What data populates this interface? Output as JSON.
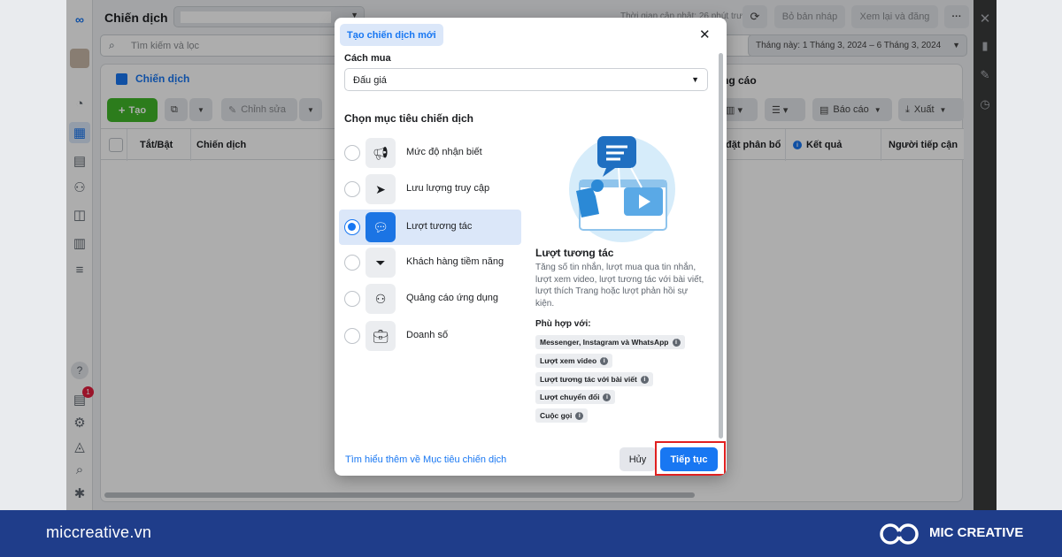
{
  "app": {
    "title": "Chiến dịch",
    "updated_text": "Thời gian cập nhật: 26 phút trước",
    "discard_label": "Bỏ bản nháp",
    "review_label": "Xem lại và đăng",
    "more_label": "···",
    "search_placeholder": "Tìm kiếm và lọc",
    "date_range": "Tháng này: 1 Tháng 3, 2024 – 6 Tháng 3, 2024",
    "tab_campaigns": "Chiến dịch",
    "tab_ads": "ng cáo",
    "create_label": "Tạo",
    "edit_label": "Chỉnh sửa",
    "reports_label": "Báo cáo",
    "export_label": "Xuất",
    "notification_count": "1",
    "columns": [
      "Tắt/Bật",
      "Chiến dịch"
    ],
    "right_columns": [
      "đặt phân bổ",
      "Kết quả",
      "Người tiếp cận"
    ]
  },
  "modal": {
    "title": "Tạo chiến dịch mới",
    "buying_type_label": "Cách mua",
    "buying_type_value": "Đấu giá",
    "objective_heading": "Chọn mục tiêu chiến dịch",
    "objectives": [
      {
        "label": "Mức độ nhận biết",
        "icon": "megaphone-icon",
        "selected": false
      },
      {
        "label": "Lưu lượng truy cập",
        "icon": "cursor-icon",
        "selected": false
      },
      {
        "label": "Lượt tương tác",
        "icon": "chat-bubbles-icon",
        "selected": true
      },
      {
        "label": "Khách hàng tiềm năng",
        "icon": "funnel-icon",
        "selected": false
      },
      {
        "label": "Quảng cáo ứng dụng",
        "icon": "people-icon",
        "selected": false
      },
      {
        "label": "Doanh số",
        "icon": "briefcase-icon",
        "selected": false
      }
    ],
    "detail_title": "Lượt tương tác",
    "detail_desc": "Tăng số tin nhắn, lượt mua qua tin nhắn, lượt xem video, lượt tương tác với bài viết, lượt thích Trang hoặc lượt phản hồi sự kiện.",
    "fit_label": "Phù hợp với:",
    "fits": [
      "Messenger, Instagram và WhatsApp",
      "Lượt xem video",
      "Lượt tương tác với bài viết",
      "Lượt chuyển đổi",
      "Cuộc gọi"
    ],
    "learn_more": "Tìm hiểu thêm về Mục tiêu chiến dịch",
    "cancel_label": "Hủy",
    "continue_label": "Tiếp tục"
  },
  "footer": {
    "site": "miccreative.vn",
    "brand": "MIC CREATIVE"
  },
  "colors": {
    "accent": "#1877f2",
    "highlight_border": "#e02020",
    "footer_bg": "#1f3d8a",
    "create_button": "#42b72a"
  }
}
